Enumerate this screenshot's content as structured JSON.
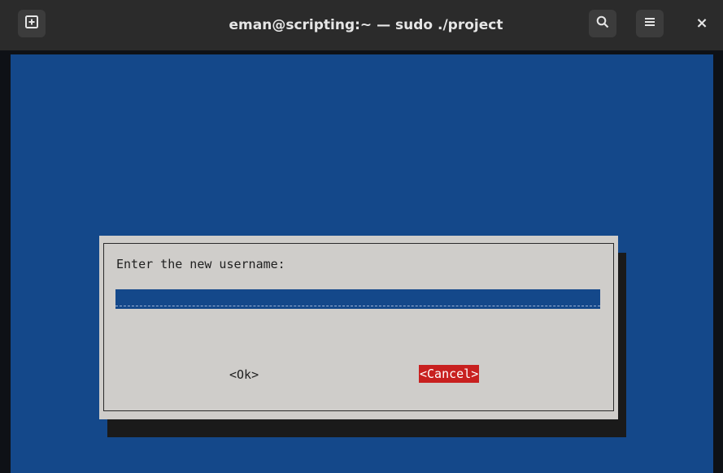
{
  "window": {
    "title": "eman@scripting:~ — sudo ./project",
    "new_tab_icon": "new-tab-icon",
    "search_icon": "search-icon",
    "menu_icon": "hamburger-menu-icon",
    "close_icon": "close-icon",
    "close_glyph": "×"
  },
  "dialog": {
    "prompt": "Enter the new username:",
    "input_value": "",
    "ok_label": "<Ok>",
    "cancel_label": "<Cancel>",
    "focused_button": "cancel"
  },
  "colors": {
    "screen_bg": "#14488a",
    "dialog_bg": "#cfcdca",
    "focus_bg": "#c8201f",
    "titlebar_bg": "#2b2b2b"
  }
}
